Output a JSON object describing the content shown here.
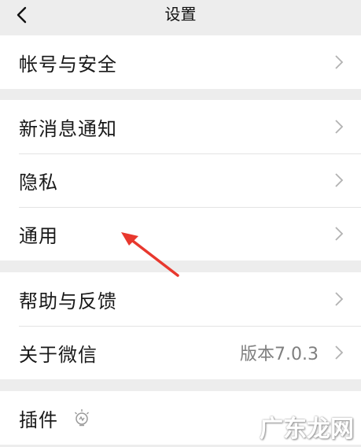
{
  "nav": {
    "back_icon": "chevron-left-icon",
    "title": "设置"
  },
  "groups": [
    {
      "rows": [
        {
          "label": "帐号与安全"
        }
      ]
    },
    {
      "rows": [
        {
          "label": "新消息通知"
        },
        {
          "label": "隐私"
        },
        {
          "label": "通用"
        }
      ]
    },
    {
      "rows": [
        {
          "label": "帮助与反馈"
        },
        {
          "label": "关于微信",
          "value": "版本7.0.3"
        }
      ]
    },
    {
      "rows": [
        {
          "label": "插件",
          "icon": "plugin-bulb-icon"
        }
      ]
    }
  ],
  "annotation": {
    "arrow_color": "#e8382e"
  },
  "watermark": {
    "text": "广东龙网"
  },
  "colors": {
    "background": "#ededed",
    "card": "#ffffff",
    "text": "#191919",
    "secondary_text": "#7f7f7f",
    "chevron": "#b2b2b2"
  }
}
